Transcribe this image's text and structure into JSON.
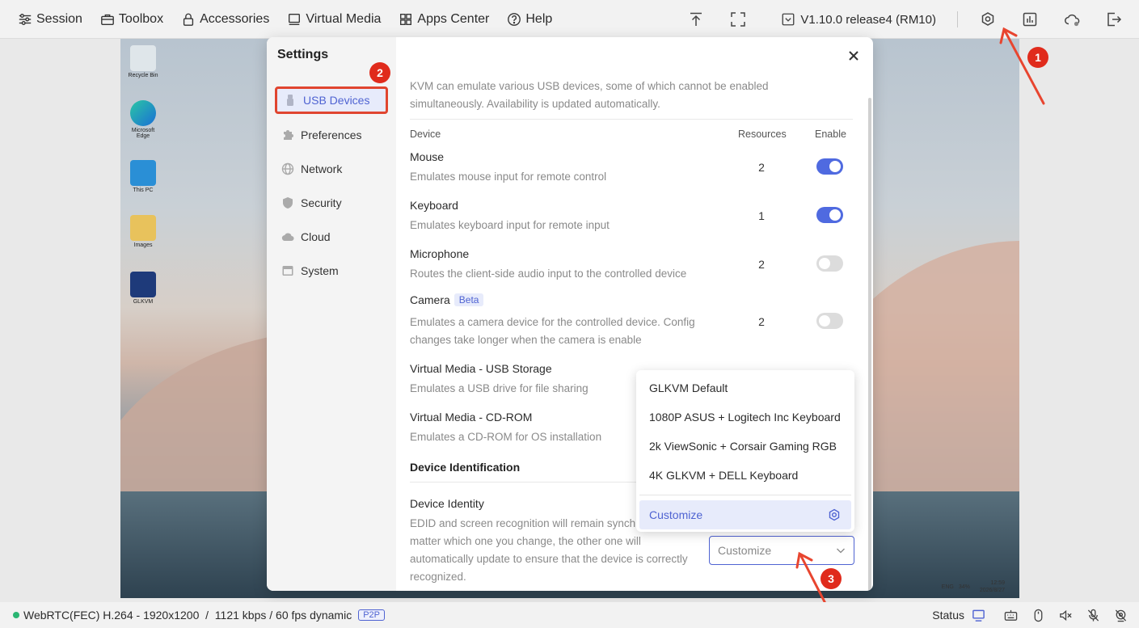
{
  "topbar": {
    "menu": [
      {
        "label": "Session",
        "icon": "sliders-icon"
      },
      {
        "label": "Toolbox",
        "icon": "toolbox-icon"
      },
      {
        "label": "Accessories",
        "icon": "lock-icon"
      },
      {
        "label": "Virtual Media",
        "icon": "monitor-icon"
      },
      {
        "label": "Apps Center",
        "icon": "apps-grid-icon"
      },
      {
        "label": "Help",
        "icon": "help-circle-icon"
      }
    ],
    "version": "V1.10.0 release4 (RM10)"
  },
  "settings": {
    "title": "Settings",
    "sidebar": [
      {
        "label": "USB Devices",
        "icon": "usb-icon",
        "active": true
      },
      {
        "label": "Preferences",
        "icon": "puzzle-icon"
      },
      {
        "label": "Network",
        "icon": "globe-icon"
      },
      {
        "label": "Security",
        "icon": "shield-icon"
      },
      {
        "label": "Cloud",
        "icon": "cloud-icon"
      },
      {
        "label": "System",
        "icon": "system-icon"
      }
    ],
    "intro": "KVM can emulate various USB devices, some of which cannot be enabled simultaneously. Availability is updated automatically.",
    "columns": {
      "device": "Device",
      "resources": "Resources",
      "enable": "Enable"
    },
    "devices": [
      {
        "name": "Mouse",
        "desc": "Emulates mouse input for remote control",
        "resources": "2",
        "enabled": true
      },
      {
        "name": "Keyboard",
        "desc": "Emulates keyboard input for remote input",
        "resources": "1",
        "enabled": true
      },
      {
        "name": "Microphone",
        "desc": "Routes the client-side audio input to the controlled device",
        "resources": "2",
        "enabled": false
      },
      {
        "name": "Camera",
        "badge": "Beta",
        "desc": "Emulates a camera device for the controlled device. Config changes take longer when the camera is enable",
        "resources": "2",
        "enabled": false
      },
      {
        "name": "Virtual Media - USB Storage",
        "desc": "Emulates a USB drive for file sharing"
      },
      {
        "name": "Virtual Media - CD-ROM",
        "desc": "Emulates a CD-ROM for OS installation"
      }
    ],
    "identification": {
      "heading": "Device Identification",
      "label": "Device Identity",
      "desc": "EDID and screen recognition will remain synchronized, no matter which one you change, the other one will automatically update to ensure that the device is correctly recognized.",
      "select_value": "Customize"
    },
    "dropdown": {
      "options": [
        "GLKVM Default",
        "1080P ASUS + Logitech Inc Keyboard",
        "2k ViewSonic + Corsair Gaming RGB",
        "4K GLKVM + DELL Keyboard"
      ],
      "selected": "Customize"
    }
  },
  "annotations": [
    "1",
    "2",
    "3"
  ],
  "desktop": {
    "icons": [
      "Recycle Bin",
      "Microsoft Edge",
      "This PC",
      "Images",
      "GLKVM"
    ],
    "tray": {
      "lang": "ENG",
      "battery": "34%",
      "time": "12:59",
      "date": "2026/8/27"
    }
  },
  "bottombar": {
    "stream": "WebRTC(FEC) H.264 - 1920x1200  /  1121 kbps / 60 fps dynamic",
    "p2p": "P2P",
    "status_label": "Status"
  },
  "colors": {
    "accent": "#4f63d2",
    "annotation": "#e02b1c",
    "connected": "#2bb673"
  }
}
